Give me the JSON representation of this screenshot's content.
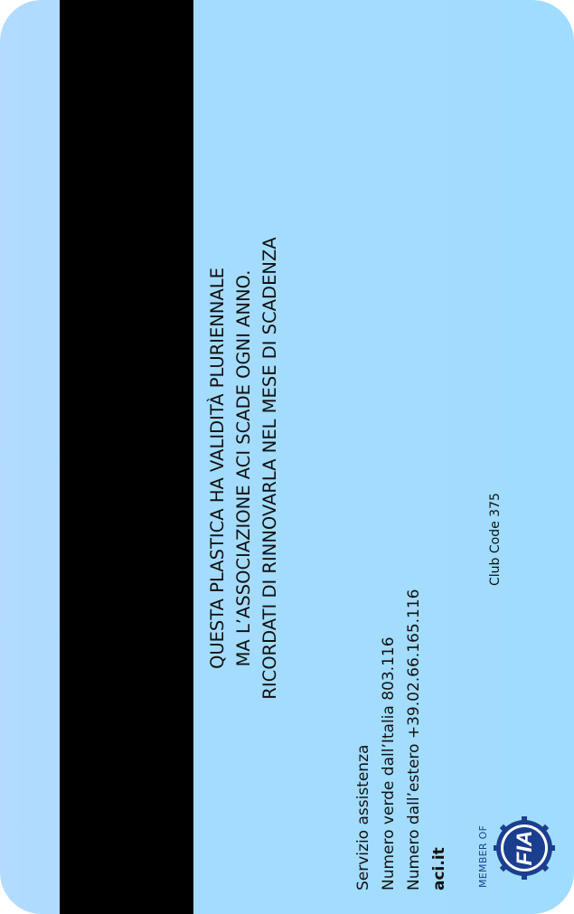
{
  "card": {
    "notice_lines": [
      "QUESTA PLASTICA HA VALIDITÀ PLURIENNALE",
      "MA L’ASSOCIAZIONE ACI SCADE OGNI ANNO.",
      "RICORDATI DI RINNOVARLA NEL MESE DI SCADENZA"
    ],
    "service": {
      "title": "Servizio assistenza",
      "italy_line": "Numero verde dall’Italia 803.116",
      "abroad_line": "Numero dall’estero +39.02.66.165.116",
      "website": "aci.it"
    },
    "club_code": "Club Code 375",
    "member_of": "MEMBER OF",
    "fia_logo_text": "FIA"
  },
  "colors": {
    "card_background": "#a0dcff",
    "stripe": "#000000",
    "fia_blue": "#1b3e8f"
  }
}
